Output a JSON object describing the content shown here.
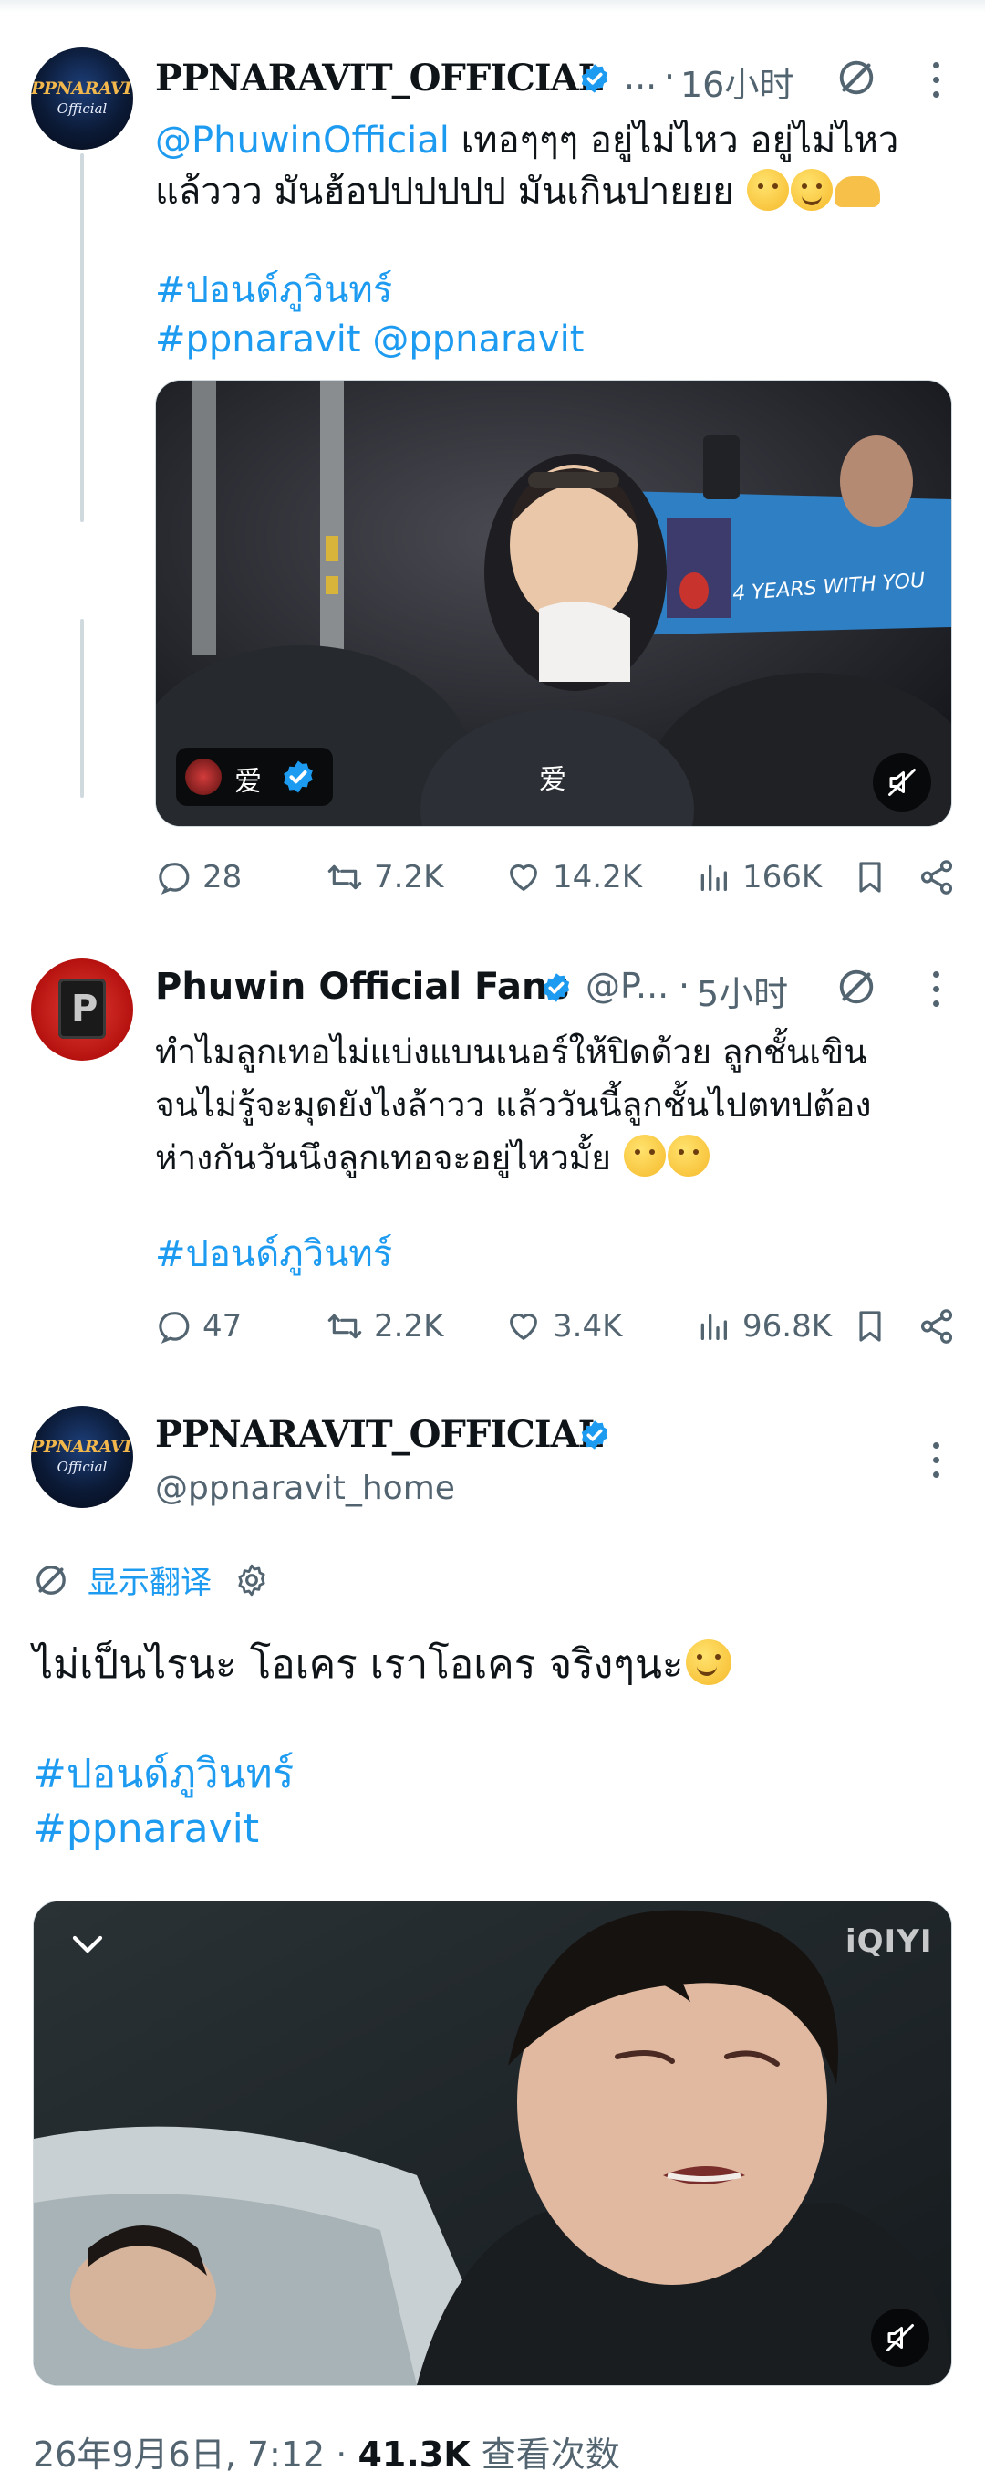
{
  "tweets": [
    {
      "name": "PPNARAVIT_OFFICIAL",
      "avatar_text": [
        "PPNARAVIT",
        "Official"
      ],
      "handle_truncated": "...",
      "time": "16小时",
      "mention": "@PhuwinOfficial",
      "text_line1": " เทอๆๆๆ อยู่ไม่ไหว อยู่ไม่ไหว",
      "text_line2": "แล้ววว มันฮ้อปปปปปป มันเกินปายยย",
      "hashtag1": "#ปอนด์ภูวินทร์",
      "hashtag2": "#ppnaravit",
      "mention2": "@ppnaravit",
      "media": {
        "banner_text": "4 YEARS WITH YOU",
        "channel_tag": "爱",
        "center_caption": "爱",
        "mute_icon": "speaker-muted-icon"
      },
      "stats": {
        "replies": "28",
        "retweets": "7.2K",
        "likes": "14.2K",
        "views": "166K"
      }
    },
    {
      "name": "Phuwin Official Fans",
      "handle_truncated": "@P...",
      "time": "5小时",
      "text_line1": "ทำไมลูกเทอไม่แบ่งแบนเนอร์ให้ปิดด้วย ลูกชั้นเขิน",
      "text_line2": "จนไม่รู้จะมุดยังไงล้าวว แล้ววันนี้ลูกชั้นไปตทปต้อง",
      "text_line3": "ห่างกันวันนึงลูกเทอจะอยู่ไหวมั้ย",
      "hashtag1": "#ปอนด์ภูวินทร์",
      "stats": {
        "replies": "47",
        "retweets": "2.2K",
        "likes": "3.4K",
        "views": "96.8K"
      }
    }
  ],
  "main_tweet": {
    "name": "PPNARAVIT_OFFICIAL",
    "avatar_text": [
      "PPNARAVIT",
      "Official"
    ],
    "handle": "@ppnaravit_home",
    "translate_label": "显示翻译",
    "text": "ไม่เป็นไรนะ โอเคร เราโอเคร จริงๆนะ",
    "hashtag1": "#ปอนด์ภูวินทร์",
    "hashtag2": "#ppnaravit",
    "video_watermark": "iQIYI",
    "date": "26年9月6日, 7:12",
    "views_count": "41.3K",
    "views_label": "查看次数"
  },
  "colors": {
    "link": "#1d9bf0",
    "muted": "#536471",
    "text": "#0f1419",
    "thread_line": "#cfd9de"
  }
}
